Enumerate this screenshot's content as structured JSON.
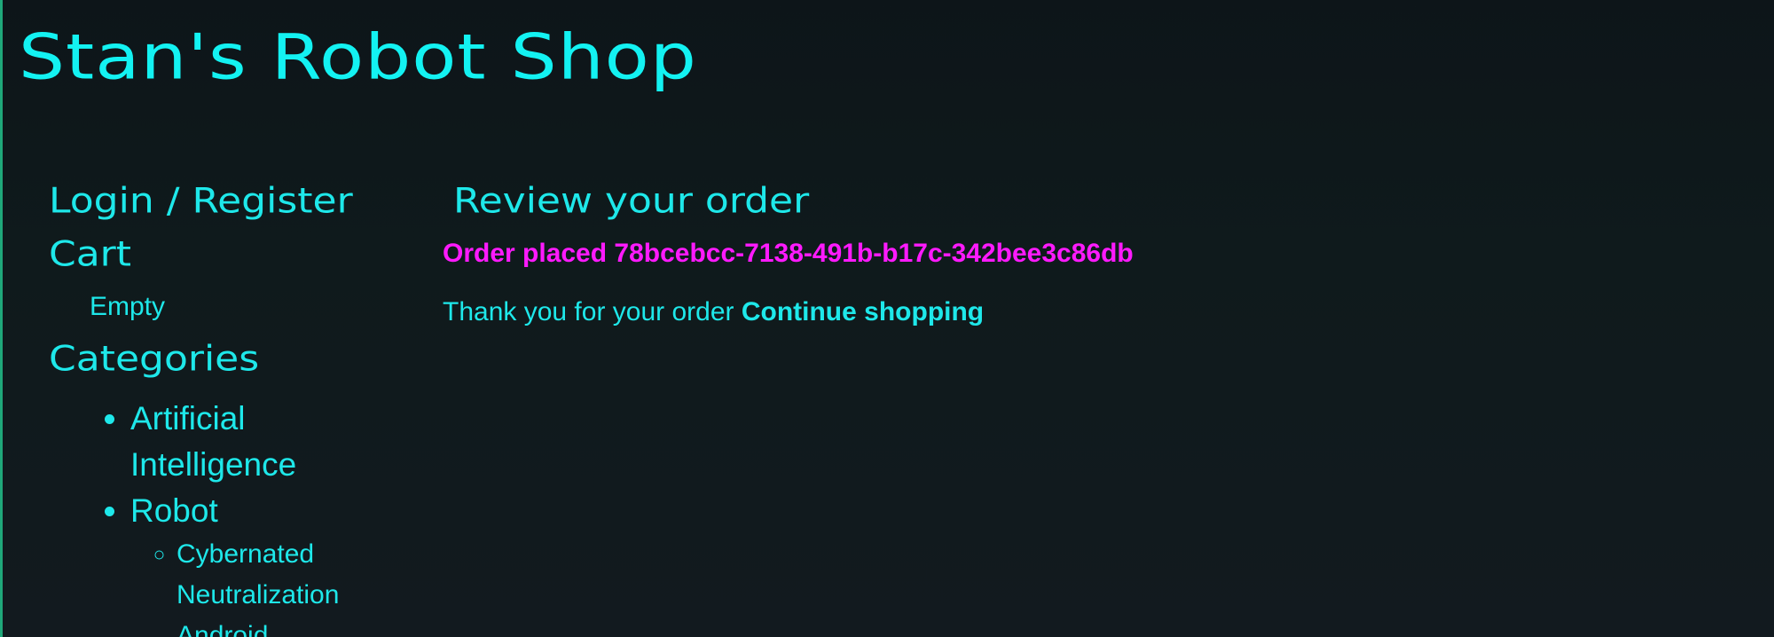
{
  "site": {
    "title": "Stan's Robot Shop"
  },
  "sidebar": {
    "login_label": "Login / Register",
    "cart": {
      "heading": "Cart",
      "status": "Empty"
    },
    "categories": {
      "heading": "Categories",
      "items": [
        {
          "label": "Artificial Intelligence"
        },
        {
          "label": "Robot",
          "children": [
            {
              "label": "Cybernated Neutralization Android"
            }
          ]
        }
      ]
    }
  },
  "main": {
    "heading": "Review your order",
    "order_placed_text": "Order placed 78bcebcc-7138-491b-b17c-342bee3c86db",
    "thank_you_text": "Thank you for your order",
    "continue_label": "Continue shopping"
  },
  "colors": {
    "accent": "#1ee8ea",
    "highlight": "#ff1aff",
    "background": "#0f1a1c"
  }
}
